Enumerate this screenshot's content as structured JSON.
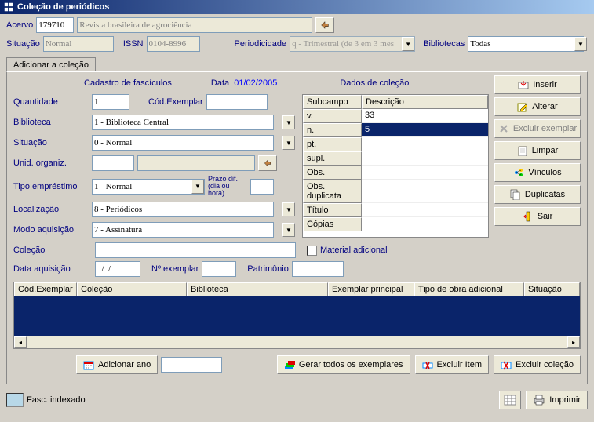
{
  "window_title": "Coleção de periódicos",
  "top": {
    "acervo_lbl": "Acervo",
    "acervo_val": "179710",
    "revista_val": "Revista brasileira de agrociência",
    "situacao_lbl": "Situação",
    "situacao_val": "Normal",
    "issn_lbl": "ISSN",
    "issn_val": "0104-8996",
    "periodicidade_lbl": "Periodicidade",
    "periodicidade_val": "q - Trimestral (de 3 em 3 mes",
    "bibliotecas_lbl": "Bibliotecas",
    "bibliotecas_val": "Todas"
  },
  "tab": "Adicionar a coleção",
  "headers": {
    "cadastro": "Cadastro de fascículos",
    "data_lbl": "Data",
    "data_val": "01/02/2005",
    "dados": "Dados de coleção"
  },
  "form": {
    "quantidade_lbl": "Quantidade",
    "quantidade_val": "1",
    "cod_exemplar_lbl": "Cód.Exemplar",
    "biblioteca_lbl": "Biblioteca",
    "biblioteca_val": "1 - Biblioteca Central",
    "situacao_lbl": "Situação",
    "situacao_val": "0 - Normal",
    "unid_lbl": "Unid. organiz.",
    "tipo_emp_lbl": "Tipo empréstimo",
    "tipo_emp_val": "1 - Normal",
    "prazo_lbl": "Prazo dif. (dia ou hora)",
    "localizacao_lbl": "Localização",
    "localizacao_val": "8 - Periódicos",
    "modo_lbl": "Modo aquisição",
    "modo_val": "7 - Assinatura",
    "colecao_lbl": "Coleção",
    "material_lbl": "Material adicional",
    "data_aq_lbl": "Data aquisição",
    "data_aq_val": "  /  /",
    "n_exemplar_lbl": "Nº exemplar",
    "patrimonio_lbl": "Patrimônio"
  },
  "subtable": {
    "h1": "Subcampo",
    "h2": "Descrição",
    "rows": [
      {
        "k": "v.",
        "v": "33"
      },
      {
        "k": "n.",
        "v": "5"
      },
      {
        "k": "pt.",
        "v": ""
      },
      {
        "k": "supl.",
        "v": ""
      },
      {
        "k": "Obs.",
        "v": ""
      },
      {
        "k": "Obs. duplicata",
        "v": ""
      },
      {
        "k": "Título",
        "v": ""
      },
      {
        "k": "Cópias",
        "v": ""
      }
    ]
  },
  "buttons": {
    "inserir": "Inserir",
    "alterar": "Alterar",
    "excluir_ex": "Excluir exemplar",
    "limpar": "Limpar",
    "vinculos": "Vínculos",
    "duplicatas": "Duplicatas",
    "sair": "Sair"
  },
  "coltable": {
    "c1": "Cód.Exemplar",
    "c2": "Coleção",
    "c3": "Biblioteca",
    "c4": "Exemplar principal",
    "c5": "Tipo de obra adicional",
    "c6": "Situação"
  },
  "bottom": {
    "adicionar_ano": "Adicionar ano",
    "gerar": "Gerar todos os exemplares",
    "excluir_item": "Excluir Item",
    "excluir_colecao": "Excluir coleção",
    "fasc": "Fasc. indexado",
    "imprimir": "Imprimir"
  }
}
